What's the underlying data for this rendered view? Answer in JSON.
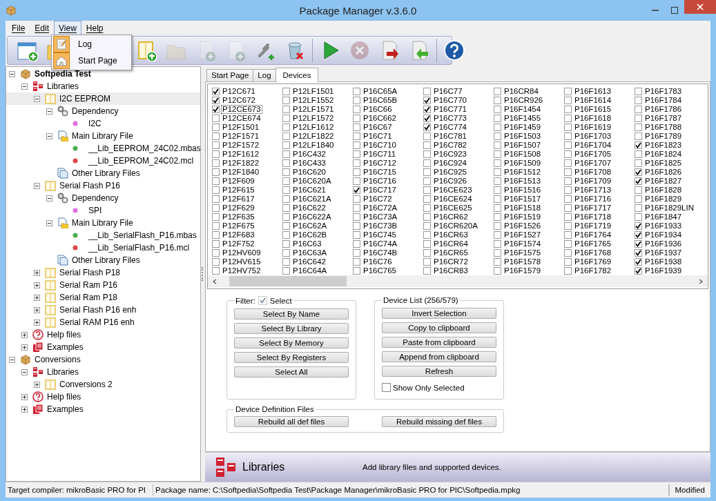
{
  "window": {
    "title": "Package Manager v.3.6.0"
  },
  "menu": [
    {
      "label": "File",
      "selected": false
    },
    {
      "label": "Edit",
      "selected": false
    },
    {
      "label": "View",
      "selected": true
    },
    {
      "label": "Help",
      "selected": false
    }
  ],
  "open_menu": {
    "items": [
      {
        "label": "Log",
        "kind": "log"
      },
      {
        "label": "Start Page",
        "kind": "home"
      }
    ]
  },
  "toolbar": [
    {
      "kind": "new",
      "disabled": false
    },
    {
      "kind": "folder",
      "disabled": false
    },
    {
      "kind": "gap"
    },
    {
      "kind": "book-add",
      "disabled": false
    },
    {
      "kind": "folder",
      "disabled": true
    },
    {
      "kind": "file-add",
      "disabled": true
    },
    {
      "kind": "doc-add",
      "disabled": true
    },
    {
      "kind": "link-add",
      "disabled": false
    },
    {
      "kind": "delete",
      "disabled": false
    },
    {
      "kind": "sep"
    },
    {
      "kind": "run",
      "disabled": false
    },
    {
      "kind": "cancel",
      "disabled": true
    },
    {
      "kind": "export",
      "disabled": false
    },
    {
      "kind": "import",
      "disabled": false
    },
    {
      "kind": "sep"
    },
    {
      "kind": "help",
      "disabled": false
    }
  ],
  "tree": [
    {
      "label": "Softpedia Test",
      "kind": "package",
      "expanded": true,
      "selected": false,
      "bold": true,
      "children": [
        {
          "label": "Libraries",
          "kind": "libraries",
          "expanded": true,
          "selected": false,
          "children": [
            {
              "label": "I2C EEPROM",
              "kind": "book",
              "expanded": true,
              "selected": true,
              "children": [
                {
                  "label": "Dependency",
                  "kind": "gears",
                  "expanded": true,
                  "selected": false,
                  "children": [
                    {
                      "label": "I2C",
                      "kind": "dot",
                      "color": "#e070e0",
                      "selected": false
                    }
                  ]
                },
                {
                  "label": "Main Library File",
                  "kind": "main-file",
                  "expanded": true,
                  "selected": false,
                  "children": [
                    {
                      "label": "__Lib_EEPROM_24C02.mbas",
                      "kind": "dot",
                      "color": "#4caf50",
                      "selected": false
                    },
                    {
                      "label": "__Lib_EEPROM_24C02.mcl",
                      "kind": "dot",
                      "color": "#e04848",
                      "selected": false
                    }
                  ]
                },
                {
                  "label": "Other Library Files",
                  "kind": "files",
                  "selected": false
                }
              ]
            },
            {
              "label": "Serial Flash P16",
              "kind": "book",
              "expanded": true,
              "selected": false,
              "children": [
                {
                  "label": "Dependency",
                  "kind": "gears",
                  "expanded": true,
                  "selected": false,
                  "children": [
                    {
                      "label": "SPI",
                      "kind": "dot",
                      "color": "#e070e0",
                      "selected": false
                    }
                  ]
                },
                {
                  "label": "Main Library File",
                  "kind": "main-file",
                  "expanded": true,
                  "selected": false,
                  "children": [
                    {
                      "label": "__Lib_SerialFlash_P16.mbas",
                      "kind": "dot",
                      "color": "#4caf50",
                      "selected": false
                    },
                    {
                      "label": "__Lib_SerialFlash_P16.mcl",
                      "kind": "dot",
                      "color": "#e04848",
                      "selected": false
                    }
                  ]
                },
                {
                  "label": "Other Library Files",
                  "kind": "files",
                  "selected": false
                }
              ]
            },
            {
              "label": "Serial Flash P18",
              "kind": "book",
              "expanded": false,
              "selected": false
            },
            {
              "label": "Serial Ram P16",
              "kind": "book",
              "expanded": false,
              "selected": false
            },
            {
              "label": "Serial Ram P18",
              "kind": "book",
              "expanded": false,
              "selected": false
            },
            {
              "label": "Serial Flash P16 enh",
              "kind": "book",
              "expanded": false,
              "selected": false
            },
            {
              "label": "Serial RAM P16 enh",
              "kind": "book",
              "expanded": false,
              "selected": false
            }
          ]
        },
        {
          "label": "Help files",
          "kind": "help",
          "expanded": false,
          "selected": false
        },
        {
          "label": "Examples",
          "kind": "examples",
          "expanded": false,
          "selected": false
        }
      ]
    },
    {
      "label": "Conversions",
      "kind": "package",
      "expanded": true,
      "selected": false,
      "bold": false,
      "children": [
        {
          "label": "Libraries",
          "kind": "libraries",
          "expanded": true,
          "selected": false,
          "children": [
            {
              "label": "Conversions 2",
              "kind": "book",
              "expanded": false,
              "selected": false
            }
          ]
        },
        {
          "label": "Help files",
          "kind": "help",
          "expanded": false,
          "selected": false
        },
        {
          "label": "Examples",
          "kind": "examples",
          "expanded": false,
          "selected": false
        }
      ]
    }
  ],
  "tabs": [
    {
      "label": "Start Page",
      "selected": false
    },
    {
      "label": "Log",
      "selected": false
    },
    {
      "label": "Devices",
      "selected": true
    }
  ],
  "devices": [
    {
      "name": "P12C671",
      "checked": true,
      "selected": false
    },
    {
      "name": "P12C672",
      "checked": true,
      "selected": false
    },
    {
      "name": "P12CE673",
      "checked": true,
      "selected": true
    },
    {
      "name": "P12CE674",
      "checked": false,
      "selected": false
    },
    {
      "name": "P12F1501",
      "checked": false,
      "selected": false
    },
    {
      "name": "P12F1571",
      "checked": false,
      "selected": false
    },
    {
      "name": "P12F1572",
      "checked": false,
      "selected": false
    },
    {
      "name": "P12F1612",
      "checked": false,
      "selected": false
    },
    {
      "name": "P12F1822",
      "checked": false,
      "selected": false
    },
    {
      "name": "P12F1840",
      "checked": false,
      "selected": false
    },
    {
      "name": "P12F609",
      "checked": false,
      "selected": false
    },
    {
      "name": "P12F615",
      "checked": false,
      "selected": false
    },
    {
      "name": "P12F617",
      "checked": false,
      "selected": false
    },
    {
      "name": "P12F629",
      "checked": false,
      "selected": false
    },
    {
      "name": "P12F635",
      "checked": false,
      "selected": false
    },
    {
      "name": "P12F675",
      "checked": false,
      "selected": false
    },
    {
      "name": "P12F683",
      "checked": false,
      "selected": false
    },
    {
      "name": "P12F752",
      "checked": false,
      "selected": false
    },
    {
      "name": "P12HV609",
      "checked": false,
      "selected": false
    },
    {
      "name": "P12HV615",
      "checked": false,
      "selected": false
    },
    {
      "name": "P12HV752",
      "checked": false,
      "selected": false
    },
    {
      "name": "P12LF1501",
      "checked": false,
      "selected": false
    },
    {
      "name": "P12LF1552",
      "checked": false,
      "selected": false
    },
    {
      "name": "P12LF1571",
      "checked": false,
      "selected": false
    },
    {
      "name": "P12LF1572",
      "checked": false,
      "selected": false
    },
    {
      "name": "P12LF1612",
      "checked": false,
      "selected": false
    },
    {
      "name": "P12LF1822",
      "checked": false,
      "selected": false
    },
    {
      "name": "P12LF1840",
      "checked": false,
      "selected": false
    },
    {
      "name": "P16C432",
      "checked": false,
      "selected": false
    },
    {
      "name": "P16C433",
      "checked": false,
      "selected": false
    },
    {
      "name": "P16C620",
      "checked": false,
      "selected": false
    },
    {
      "name": "P16C620A",
      "checked": false,
      "selected": false
    },
    {
      "name": "P16C621",
      "checked": false,
      "selected": false
    },
    {
      "name": "P16C621A",
      "checked": false,
      "selected": false
    },
    {
      "name": "P16C622",
      "checked": false,
      "selected": false
    },
    {
      "name": "P16C622A",
      "checked": false,
      "selected": false
    },
    {
      "name": "P16C62A",
      "checked": false,
      "selected": false
    },
    {
      "name": "P16C62B",
      "checked": false,
      "selected": false
    },
    {
      "name": "P16C63",
      "checked": false,
      "selected": false
    },
    {
      "name": "P16C63A",
      "checked": false,
      "selected": false
    },
    {
      "name": "P16C642",
      "checked": false,
      "selected": false
    },
    {
      "name": "P16C64A",
      "checked": false,
      "selected": false
    },
    {
      "name": "P16C65A",
      "checked": false,
      "selected": false
    },
    {
      "name": "P16C65B",
      "checked": false,
      "selected": false
    },
    {
      "name": "P16C66",
      "checked": false,
      "selected": false
    },
    {
      "name": "P16C662",
      "checked": false,
      "selected": false
    },
    {
      "name": "P16C67",
      "checked": false,
      "selected": false
    },
    {
      "name": "P16C71",
      "checked": false,
      "selected": false
    },
    {
      "name": "P16C710",
      "checked": false,
      "selected": false
    },
    {
      "name": "P16C711",
      "checked": false,
      "selected": false
    },
    {
      "name": "P16C712",
      "checked": false,
      "selected": false
    },
    {
      "name": "P16C715",
      "checked": false,
      "selected": false
    },
    {
      "name": "P16C716",
      "checked": false,
      "selected": false
    },
    {
      "name": "P16C717",
      "checked": true,
      "selected": false
    },
    {
      "name": "P16C72",
      "checked": false,
      "selected": false
    },
    {
      "name": "P16C72A",
      "checked": false,
      "selected": false
    },
    {
      "name": "P16C73A",
      "checked": false,
      "selected": false
    },
    {
      "name": "P16C73B",
      "checked": false,
      "selected": false
    },
    {
      "name": "P16C745",
      "checked": false,
      "selected": false
    },
    {
      "name": "P16C74A",
      "checked": false,
      "selected": false
    },
    {
      "name": "P16C74B",
      "checked": false,
      "selected": false
    },
    {
      "name": "P16C76",
      "checked": false,
      "selected": false
    },
    {
      "name": "P16C765",
      "checked": false,
      "selected": false
    },
    {
      "name": "P16C77",
      "checked": false,
      "selected": false
    },
    {
      "name": "P16C770",
      "checked": true,
      "selected": false
    },
    {
      "name": "P16C771",
      "checked": true,
      "selected": false
    },
    {
      "name": "P16C773",
      "checked": true,
      "selected": false
    },
    {
      "name": "P16C774",
      "checked": true,
      "selected": false
    },
    {
      "name": "P16C781",
      "checked": false,
      "selected": false
    },
    {
      "name": "P16C782",
      "checked": false,
      "selected": false
    },
    {
      "name": "P16C923",
      "checked": false,
      "selected": false
    },
    {
      "name": "P16C924",
      "checked": false,
      "selected": false
    },
    {
      "name": "P16C925",
      "checked": false,
      "selected": false
    },
    {
      "name": "P16C926",
      "checked": false,
      "selected": false
    },
    {
      "name": "P16CE623",
      "checked": false,
      "selected": false
    },
    {
      "name": "P16CE624",
      "checked": false,
      "selected": false
    },
    {
      "name": "P16CE625",
      "checked": false,
      "selected": false
    },
    {
      "name": "P16CR62",
      "checked": false,
      "selected": false
    },
    {
      "name": "P16CR620A",
      "checked": false,
      "selected": false
    },
    {
      "name": "P16CR63",
      "checked": false,
      "selected": false
    },
    {
      "name": "P16CR64",
      "checked": false,
      "selected": false
    },
    {
      "name": "P16CR65",
      "checked": false,
      "selected": false
    },
    {
      "name": "P16CR72",
      "checked": false,
      "selected": false
    },
    {
      "name": "P16CR83",
      "checked": false,
      "selected": false
    },
    {
      "name": "P16CR84",
      "checked": false,
      "selected": false
    },
    {
      "name": "P16CR926",
      "checked": false,
      "selected": false
    },
    {
      "name": "P16F1454",
      "checked": false,
      "selected": false
    },
    {
      "name": "P16F1455",
      "checked": false,
      "selected": false
    },
    {
      "name": "P16F1459",
      "checked": false,
      "selected": false
    },
    {
      "name": "P16F1503",
      "checked": false,
      "selected": false
    },
    {
      "name": "P16F1507",
      "checked": false,
      "selected": false
    },
    {
      "name": "P16F1508",
      "checked": false,
      "selected": false
    },
    {
      "name": "P16F1509",
      "checked": false,
      "selected": false
    },
    {
      "name": "P16F1512",
      "checked": false,
      "selected": false
    },
    {
      "name": "P16F1513",
      "checked": false,
      "selected": false
    },
    {
      "name": "P16F1516",
      "checked": false,
      "selected": false
    },
    {
      "name": "P16F1517",
      "checked": false,
      "selected": false
    },
    {
      "name": "P16F1518",
      "checked": false,
      "selected": false
    },
    {
      "name": "P16F1519",
      "checked": false,
      "selected": false
    },
    {
      "name": "P16F1526",
      "checked": false,
      "selected": false
    },
    {
      "name": "P16F1527",
      "checked": false,
      "selected": false
    },
    {
      "name": "P16F1574",
      "checked": false,
      "selected": false
    },
    {
      "name": "P16F1575",
      "checked": false,
      "selected": false
    },
    {
      "name": "P16F1578",
      "checked": false,
      "selected": false
    },
    {
      "name": "P16F1579",
      "checked": false,
      "selected": false
    },
    {
      "name": "P16F1613",
      "checked": false,
      "selected": false
    },
    {
      "name": "P16F1614",
      "checked": false,
      "selected": false
    },
    {
      "name": "P16F1615",
      "checked": false,
      "selected": false
    },
    {
      "name": "P16F1618",
      "checked": false,
      "selected": false
    },
    {
      "name": "P16F1619",
      "checked": false,
      "selected": false
    },
    {
      "name": "P16F1703",
      "checked": false,
      "selected": false
    },
    {
      "name": "P16F1704",
      "checked": false,
      "selected": false
    },
    {
      "name": "P16F1705",
      "checked": false,
      "selected": false
    },
    {
      "name": "P16F1707",
      "checked": false,
      "selected": false
    },
    {
      "name": "P16F1708",
      "checked": false,
      "selected": false
    },
    {
      "name": "P16F1709",
      "checked": false,
      "selected": false
    },
    {
      "name": "P16F1713",
      "checked": false,
      "selected": false
    },
    {
      "name": "P16F1716",
      "checked": false,
      "selected": false
    },
    {
      "name": "P16F1717",
      "checked": false,
      "selected": false
    },
    {
      "name": "P16F1718",
      "checked": false,
      "selected": false
    },
    {
      "name": "P16F1719",
      "checked": false,
      "selected": false
    },
    {
      "name": "P16F1764",
      "checked": false,
      "selected": false
    },
    {
      "name": "P16F1765",
      "checked": false,
      "selected": false
    },
    {
      "name": "P16F1768",
      "checked": false,
      "selected": false
    },
    {
      "name": "P16F1769",
      "checked": false,
      "selected": false
    },
    {
      "name": "P16F1782",
      "checked": false,
      "selected": false
    },
    {
      "name": "P16F1783",
      "checked": false,
      "selected": false
    },
    {
      "name": "P16F1784",
      "checked": false,
      "selected": false
    },
    {
      "name": "P16F1786",
      "checked": false,
      "selected": false
    },
    {
      "name": "P16F1787",
      "checked": false,
      "selected": false
    },
    {
      "name": "P16F1788",
      "checked": false,
      "selected": false
    },
    {
      "name": "P16F1789",
      "checked": false,
      "selected": false
    },
    {
      "name": "P16F1823",
      "checked": true,
      "selected": false
    },
    {
      "name": "P16F1824",
      "checked": false,
      "selected": false
    },
    {
      "name": "P16F1825",
      "checked": false,
      "selected": false
    },
    {
      "name": "P16F1826",
      "checked": true,
      "selected": false
    },
    {
      "name": "P16F1827",
      "checked": true,
      "selected": false
    },
    {
      "name": "P16F1828",
      "checked": false,
      "selected": false
    },
    {
      "name": "P16F1829",
      "checked": false,
      "selected": false
    },
    {
      "name": "P16F1829LIN",
      "checked": false,
      "selected": false
    },
    {
      "name": "P16F1847",
      "checked": false,
      "selected": false
    },
    {
      "name": "P16F1933",
      "checked": true,
      "selected": false
    },
    {
      "name": "P16F1934",
      "checked": true,
      "selected": false
    },
    {
      "name": "P16F1936",
      "checked": true,
      "selected": false
    },
    {
      "name": "P16F1937",
      "checked": true,
      "selected": false
    },
    {
      "name": "P16F1938",
      "checked": true,
      "selected": false
    },
    {
      "name": "P16F1939",
      "checked": true,
      "selected": false
    }
  ],
  "filter": {
    "label": "Filter:",
    "checkbox": {
      "label": "Select",
      "checked": true,
      "disabled": true
    },
    "buttons": [
      "Select By Name",
      "Select By Library",
      "Select By Memory",
      "Select By Registers",
      "Select All"
    ]
  },
  "device_list": {
    "title": "Device List (256/579)",
    "buttons": [
      "Invert Selection",
      "Copy to clipboard",
      "Paste from clipboard",
      "Append from clipboard",
      "Refresh"
    ],
    "checkbox": {
      "label": "Show Only Selected",
      "checked": false
    }
  },
  "definition_files": {
    "title": "Device Definition Files",
    "buttons": [
      "Rebuild all def files",
      "Rebuild missing def files"
    ]
  },
  "header": {
    "title": "Libraries",
    "description": "Add library files and supported devices."
  },
  "status_bar": [
    "Target compiler: mikroBasic PRO for PI",
    "Package name: C:\\Softpedia\\Softpedia Test\\Package Manager\\mikroBasic PRO for PIC\\Softpedia.mpkg",
    "Modified"
  ]
}
